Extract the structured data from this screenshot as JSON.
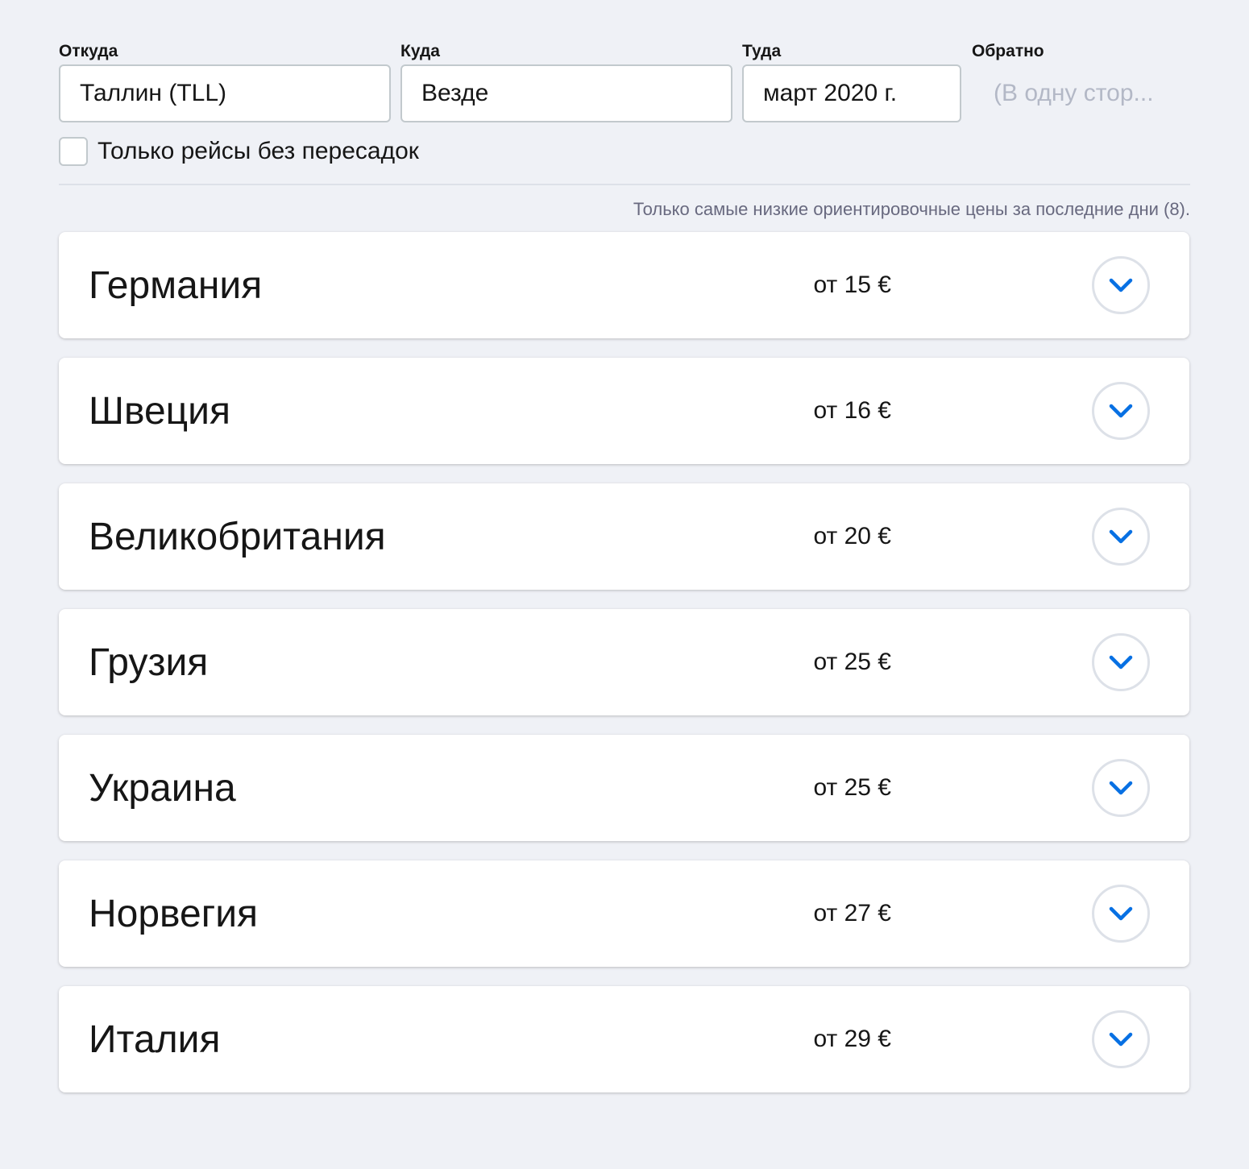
{
  "search": {
    "from_label": "Откуда",
    "from_value": "Таллин (TLL)",
    "to_label": "Куда",
    "to_value": "Везде",
    "depart_label": "Туда",
    "depart_value": "март 2020 г.",
    "return_label": "Обратно",
    "return_placeholder": "(В одну стор..."
  },
  "filters": {
    "direct_only_label": "Только рейсы без пересадок",
    "direct_only_checked": false
  },
  "disclaimer": "Только самые низкие ориентировочные цены за последние дни (8).",
  "colors": {
    "accent": "#0770e3",
    "background": "#eff1f6",
    "text": "#161616",
    "muted": "#68697f",
    "border": "#c2c9cd"
  },
  "results": [
    {
      "country": "Германия",
      "price": "от 15 €",
      "icon": "chevron-down-icon"
    },
    {
      "country": "Швеция",
      "price": "от 16 €",
      "icon": "chevron-down-icon"
    },
    {
      "country": "Великобритания",
      "price": "от 20 €",
      "icon": "chevron-down-icon"
    },
    {
      "country": "Грузия",
      "price": "от 25 €",
      "icon": "chevron-down-icon"
    },
    {
      "country": "Украина",
      "price": "от 25 €",
      "icon": "chevron-down-icon"
    },
    {
      "country": "Норвегия",
      "price": "от 27 €",
      "icon": "chevron-down-icon"
    },
    {
      "country": "Италия",
      "price": "от 29 €",
      "icon": "chevron-down-icon"
    }
  ]
}
